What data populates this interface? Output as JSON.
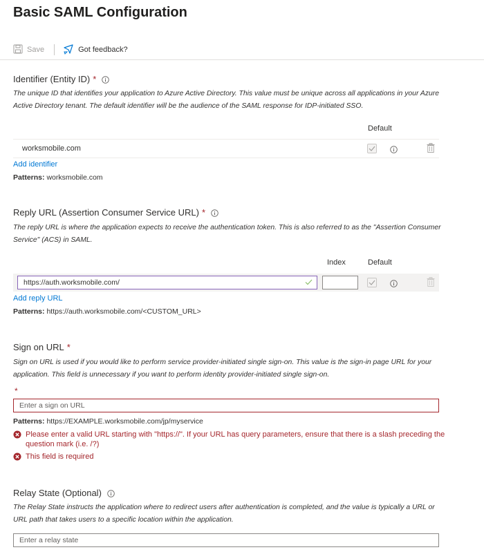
{
  "page_title": "Basic SAML Configuration",
  "toolbar": {
    "save_label": "Save",
    "feedback_label": "Got feedback?"
  },
  "identifier": {
    "title": "Identifier (Entity ID)",
    "required_mark": "*",
    "description": "The unique ID that identifies your application to Azure Active Directory. This value must be unique across all applications in your Azure Active Directory tenant. The default identifier will be the audience of the SAML response for IDP-initiated SSO.",
    "col_default": "Default",
    "rows": [
      {
        "value": "worksmobile.com",
        "default_checked": true
      }
    ],
    "add_link": "Add identifier",
    "patterns_label": "Patterns:",
    "patterns_value": "worksmobile.com"
  },
  "reply_url": {
    "title": "Reply URL (Assertion Consumer Service URL)",
    "required_mark": "*",
    "description": "The reply URL is where the application expects to receive the authentication token. This is also referred to as the \"Assertion Consumer Service\" (ACS) in SAML.",
    "col_index": "Index",
    "col_default": "Default",
    "rows": [
      {
        "value": "https://auth.worksmobile.com/",
        "index": "",
        "default_checked": true
      }
    ],
    "add_link": "Add reply URL",
    "patterns_label": "Patterns:",
    "patterns_value": "https://auth.worksmobile.com/<CUSTOM_URL>"
  },
  "sign_on_url": {
    "title": "Sign on URL",
    "required_mark": "*",
    "description": "Sign on URL is used if you would like to perform service provider-initiated single sign-on. This value is the sign-in page URL for your application. This field is unnecessary if you want to perform identity provider-initiated single sign-on.",
    "field_required_mark": "*",
    "placeholder": "Enter a sign on URL",
    "patterns_label": "Patterns:",
    "patterns_value": "https://EXAMPLE.worksmobile.com/jp/myservice",
    "errors": [
      "Please enter a valid URL starting with \"https://\". If your URL has query parameters, ensure that there is a slash preceding the question mark (i.e. /?)",
      "This field is required"
    ]
  },
  "relay_state": {
    "title": "Relay State (Optional)",
    "description": "The Relay State instructs the application where to redirect users after authentication is completed, and the value is typically a URL or URL path that takes users to a specific location within the application.",
    "placeholder": "Enter a relay state"
  },
  "colors": {
    "accent": "#0078d4",
    "error": "#a4262c",
    "focus_border": "#8764b8",
    "valid_check": "#8cbf6a"
  }
}
